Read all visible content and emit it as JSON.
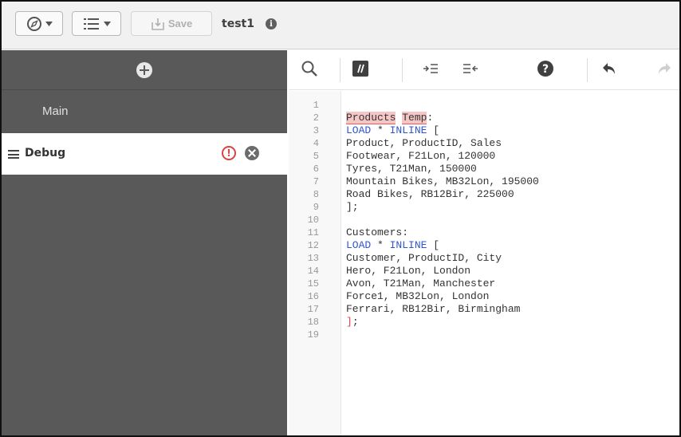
{
  "toolbar": {
    "navigation_icon": "compass-icon",
    "menu_icon": "list-icon",
    "save_label": "Save",
    "app_name": "test1",
    "info_icon": "info-icon"
  },
  "sidebar": {
    "add_icon": "plus-icon",
    "sections": [
      {
        "label": "Main"
      },
      {
        "label": "Debug",
        "selected": true,
        "has_error": true
      }
    ]
  },
  "editor_toolbar": {
    "icons": [
      "search-icon",
      "comment-icon",
      "indent-icon",
      "outdent-icon",
      "help-icon",
      "undo-icon",
      "redo-icon"
    ]
  },
  "code": {
    "line_numbers": [
      "1",
      "2",
      "3",
      "4",
      "5",
      "6",
      "7",
      "8",
      "9",
      "10",
      "11",
      "12",
      "13",
      "14",
      "15",
      "16",
      "17",
      "18",
      "19"
    ],
    "lines": [
      {
        "n": "1",
        "segments": []
      },
      {
        "n": "2",
        "segments": [
          {
            "text": "Products",
            "style": "err"
          },
          {
            "text": " ",
            "style": ""
          },
          {
            "text": "Temp",
            "style": "err"
          },
          {
            "text": ":",
            "style": ""
          }
        ]
      },
      {
        "n": "3",
        "segments": [
          {
            "text": "LOAD",
            "style": "kw"
          },
          {
            "text": " * ",
            "style": ""
          },
          {
            "text": "INLINE",
            "style": "kw"
          },
          {
            "text": " [",
            "style": ""
          }
        ]
      },
      {
        "n": "4",
        "segments": [
          {
            "text": "Product, ProductID, Sales",
            "style": ""
          }
        ]
      },
      {
        "n": "5",
        "segments": [
          {
            "text": "Footwear, F21Lon, 120000",
            "style": ""
          }
        ]
      },
      {
        "n": "6",
        "segments": [
          {
            "text": "Tyres, T21Man, 150000",
            "style": ""
          }
        ]
      },
      {
        "n": "7",
        "segments": [
          {
            "text": "Mountain Bikes, MB32Lon, 195000",
            "style": ""
          }
        ]
      },
      {
        "n": "8",
        "segments": [
          {
            "text": "Road Bikes, RB12Bir, 225000",
            "style": ""
          }
        ]
      },
      {
        "n": "9",
        "segments": [
          {
            "text": "];",
            "style": ""
          }
        ]
      },
      {
        "n": "10",
        "segments": []
      },
      {
        "n": "11",
        "segments": [
          {
            "text": "Customers:",
            "style": ""
          }
        ]
      },
      {
        "n": "12",
        "segments": [
          {
            "text": "LOAD",
            "style": "kw"
          },
          {
            "text": " * ",
            "style": ""
          },
          {
            "text": "INLINE",
            "style": "kw"
          },
          {
            "text": " [",
            "style": ""
          }
        ]
      },
      {
        "n": "13",
        "segments": [
          {
            "text": "Customer, ProductID, City",
            "style": ""
          }
        ]
      },
      {
        "n": "14",
        "segments": [
          {
            "text": "Hero, F21Lon, London",
            "style": ""
          }
        ]
      },
      {
        "n": "15",
        "segments": [
          {
            "text": "Avon, T21Man, Manchester",
            "style": ""
          }
        ]
      },
      {
        "n": "16",
        "segments": [
          {
            "text": "Force1, MB32Lon, London",
            "style": ""
          }
        ]
      },
      {
        "n": "17",
        "segments": [
          {
            "text": "Ferrari, RB12Bir, Birmingham",
            "style": ""
          }
        ]
      },
      {
        "n": "18",
        "segments": [
          {
            "text": "]",
            "style": "red"
          },
          {
            "text": ";",
            "style": ""
          }
        ]
      },
      {
        "n": "19",
        "segments": []
      }
    ]
  },
  "colors": {
    "sidebar_bg": "#595959",
    "keyword": "#2f55d4",
    "error_highlight": "#f5c6c6",
    "error_icon": "#dc423f"
  }
}
